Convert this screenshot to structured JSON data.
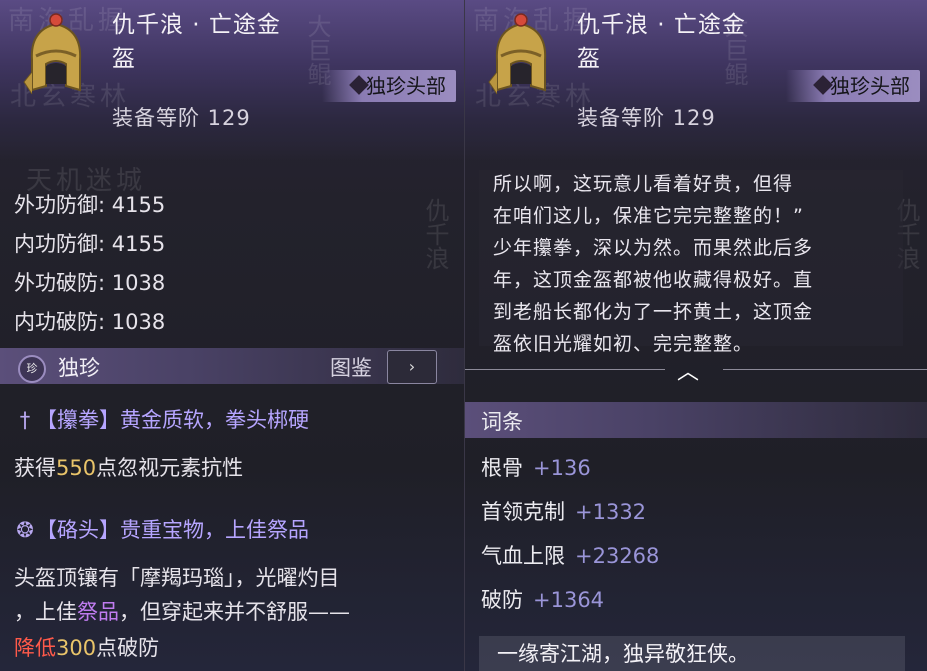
{
  "item": {
    "name": "仇千浪 · 亡途金盔",
    "name_line1": "仇千浪 · 亡途金",
    "name_line2": "盔",
    "rarity_tag": "独珍头部",
    "rarity_gem": "珍",
    "rank": "装备等阶 129"
  },
  "background": {
    "texts": [
      "南海乱握",
      "北玄寒林",
      "天机迷城"
    ],
    "vertical": [
      "大巨鲲",
      "仇千浪"
    ]
  },
  "stats": [
    {
      "label": "外功防御",
      "value": "4155"
    },
    {
      "label": "内功防御",
      "value": "4155"
    },
    {
      "label": "外功破防",
      "value": "1038"
    },
    {
      "label": "内功破防",
      "value": "1038"
    }
  ],
  "unique": {
    "gem": "珍",
    "label": "独珍",
    "tujian": "图鉴",
    "tujian_icon": "chevron-right-icon"
  },
  "effects": [
    {
      "icon": "dagger-icon",
      "symbol": "†",
      "title": "【攥拳】黄金质软，拳头梆硬",
      "desc_pre": "获得",
      "desc_num": "550",
      "desc_post": "点忽视元素抗性"
    },
    {
      "icon": "swirl-icon",
      "symbol": "❂",
      "title": "【硌头】贵重宝物，上佳祭品",
      "line1": "头盔顶镶有「摩羯玛瑙」，光曜灼目",
      "line2_pre": "，上佳",
      "line2_hl": "祭品",
      "line2_post": "，但穿起来并不舒服——",
      "line3_red": "降低",
      "line3_num": "300",
      "line3_post": "点破防"
    }
  ],
  "lore": [
    "所以啊，这玩意儿看着好贵，但得",
    "在咱们这儿，保准它完完整整的！”",
    "少年攥拳，深以为然。而果然此后多",
    "年，这顶金盔都被他收藏得极好。直",
    "到老船长都化为了一抔黄土，这顶金",
    "盔依旧光耀如初、完完整整。"
  ],
  "collapse_icon": "chevron-up-icon",
  "attributes_title": "词条",
  "attributes": [
    {
      "label": "根骨",
      "value": "+136"
    },
    {
      "label": "首领克制",
      "value": "+1332"
    },
    {
      "label": "气血上限",
      "value": "+23268"
    },
    {
      "label": "破防",
      "value": "+1364"
    }
  ],
  "quote": "一缘寄江湖，独异敬狂侠。",
  "colors": {
    "accent": "#9b8dc0",
    "gold": "#e9c46a",
    "red": "#ff5a4a",
    "stat_value": "#9a95d8"
  }
}
